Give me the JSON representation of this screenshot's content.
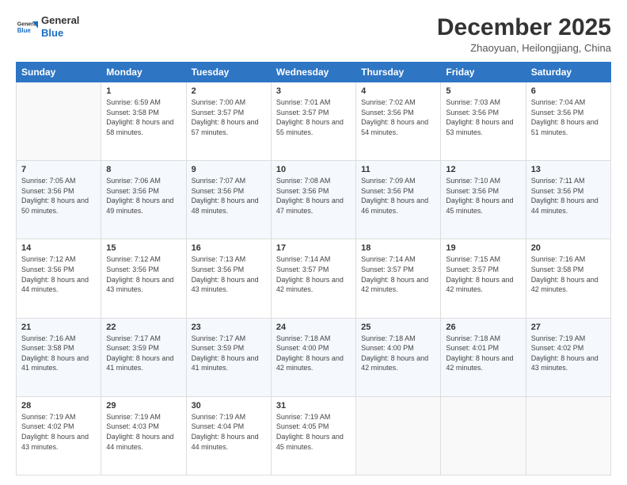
{
  "logo": {
    "line1": "General",
    "line2": "Blue"
  },
  "header": {
    "month": "December 2025",
    "location": "Zhaoyuan, Heilongjiang, China"
  },
  "weekdays": [
    "Sunday",
    "Monday",
    "Tuesday",
    "Wednesday",
    "Thursday",
    "Friday",
    "Saturday"
  ],
  "weeks": [
    [
      {
        "day": "",
        "sunrise": "",
        "sunset": "",
        "daylight": ""
      },
      {
        "day": "1",
        "sunrise": "Sunrise: 6:59 AM",
        "sunset": "Sunset: 3:58 PM",
        "daylight": "Daylight: 8 hours and 58 minutes."
      },
      {
        "day": "2",
        "sunrise": "Sunrise: 7:00 AM",
        "sunset": "Sunset: 3:57 PM",
        "daylight": "Daylight: 8 hours and 57 minutes."
      },
      {
        "day": "3",
        "sunrise": "Sunrise: 7:01 AM",
        "sunset": "Sunset: 3:57 PM",
        "daylight": "Daylight: 8 hours and 55 minutes."
      },
      {
        "day": "4",
        "sunrise": "Sunrise: 7:02 AM",
        "sunset": "Sunset: 3:56 PM",
        "daylight": "Daylight: 8 hours and 54 minutes."
      },
      {
        "day": "5",
        "sunrise": "Sunrise: 7:03 AM",
        "sunset": "Sunset: 3:56 PM",
        "daylight": "Daylight: 8 hours and 53 minutes."
      },
      {
        "day": "6",
        "sunrise": "Sunrise: 7:04 AM",
        "sunset": "Sunset: 3:56 PM",
        "daylight": "Daylight: 8 hours and 51 minutes."
      }
    ],
    [
      {
        "day": "7",
        "sunrise": "Sunrise: 7:05 AM",
        "sunset": "Sunset: 3:56 PM",
        "daylight": "Daylight: 8 hours and 50 minutes."
      },
      {
        "day": "8",
        "sunrise": "Sunrise: 7:06 AM",
        "sunset": "Sunset: 3:56 PM",
        "daylight": "Daylight: 8 hours and 49 minutes."
      },
      {
        "day": "9",
        "sunrise": "Sunrise: 7:07 AM",
        "sunset": "Sunset: 3:56 PM",
        "daylight": "Daylight: 8 hours and 48 minutes."
      },
      {
        "day": "10",
        "sunrise": "Sunrise: 7:08 AM",
        "sunset": "Sunset: 3:56 PM",
        "daylight": "Daylight: 8 hours and 47 minutes."
      },
      {
        "day": "11",
        "sunrise": "Sunrise: 7:09 AM",
        "sunset": "Sunset: 3:56 PM",
        "daylight": "Daylight: 8 hours and 46 minutes."
      },
      {
        "day": "12",
        "sunrise": "Sunrise: 7:10 AM",
        "sunset": "Sunset: 3:56 PM",
        "daylight": "Daylight: 8 hours and 45 minutes."
      },
      {
        "day": "13",
        "sunrise": "Sunrise: 7:11 AM",
        "sunset": "Sunset: 3:56 PM",
        "daylight": "Daylight: 8 hours and 44 minutes."
      }
    ],
    [
      {
        "day": "14",
        "sunrise": "Sunrise: 7:12 AM",
        "sunset": "Sunset: 3:56 PM",
        "daylight": "Daylight: 8 hours and 44 minutes."
      },
      {
        "day": "15",
        "sunrise": "Sunrise: 7:12 AM",
        "sunset": "Sunset: 3:56 PM",
        "daylight": "Daylight: 8 hours and 43 minutes."
      },
      {
        "day": "16",
        "sunrise": "Sunrise: 7:13 AM",
        "sunset": "Sunset: 3:56 PM",
        "daylight": "Daylight: 8 hours and 43 minutes."
      },
      {
        "day": "17",
        "sunrise": "Sunrise: 7:14 AM",
        "sunset": "Sunset: 3:57 PM",
        "daylight": "Daylight: 8 hours and 42 minutes."
      },
      {
        "day": "18",
        "sunrise": "Sunrise: 7:14 AM",
        "sunset": "Sunset: 3:57 PM",
        "daylight": "Daylight: 8 hours and 42 minutes."
      },
      {
        "day": "19",
        "sunrise": "Sunrise: 7:15 AM",
        "sunset": "Sunset: 3:57 PM",
        "daylight": "Daylight: 8 hours and 42 minutes."
      },
      {
        "day": "20",
        "sunrise": "Sunrise: 7:16 AM",
        "sunset": "Sunset: 3:58 PM",
        "daylight": "Daylight: 8 hours and 42 minutes."
      }
    ],
    [
      {
        "day": "21",
        "sunrise": "Sunrise: 7:16 AM",
        "sunset": "Sunset: 3:58 PM",
        "daylight": "Daylight: 8 hours and 41 minutes."
      },
      {
        "day": "22",
        "sunrise": "Sunrise: 7:17 AM",
        "sunset": "Sunset: 3:59 PM",
        "daylight": "Daylight: 8 hours and 41 minutes."
      },
      {
        "day": "23",
        "sunrise": "Sunrise: 7:17 AM",
        "sunset": "Sunset: 3:59 PM",
        "daylight": "Daylight: 8 hours and 41 minutes."
      },
      {
        "day": "24",
        "sunrise": "Sunrise: 7:18 AM",
        "sunset": "Sunset: 4:00 PM",
        "daylight": "Daylight: 8 hours and 42 minutes."
      },
      {
        "day": "25",
        "sunrise": "Sunrise: 7:18 AM",
        "sunset": "Sunset: 4:00 PM",
        "daylight": "Daylight: 8 hours and 42 minutes."
      },
      {
        "day": "26",
        "sunrise": "Sunrise: 7:18 AM",
        "sunset": "Sunset: 4:01 PM",
        "daylight": "Daylight: 8 hours and 42 minutes."
      },
      {
        "day": "27",
        "sunrise": "Sunrise: 7:19 AM",
        "sunset": "Sunset: 4:02 PM",
        "daylight": "Daylight: 8 hours and 43 minutes."
      }
    ],
    [
      {
        "day": "28",
        "sunrise": "Sunrise: 7:19 AM",
        "sunset": "Sunset: 4:02 PM",
        "daylight": "Daylight: 8 hours and 43 minutes."
      },
      {
        "day": "29",
        "sunrise": "Sunrise: 7:19 AM",
        "sunset": "Sunset: 4:03 PM",
        "daylight": "Daylight: 8 hours and 44 minutes."
      },
      {
        "day": "30",
        "sunrise": "Sunrise: 7:19 AM",
        "sunset": "Sunset: 4:04 PM",
        "daylight": "Daylight: 8 hours and 44 minutes."
      },
      {
        "day": "31",
        "sunrise": "Sunrise: 7:19 AM",
        "sunset": "Sunset: 4:05 PM",
        "daylight": "Daylight: 8 hours and 45 minutes."
      },
      {
        "day": "",
        "sunrise": "",
        "sunset": "",
        "daylight": ""
      },
      {
        "day": "",
        "sunrise": "",
        "sunset": "",
        "daylight": ""
      },
      {
        "day": "",
        "sunrise": "",
        "sunset": "",
        "daylight": ""
      }
    ]
  ]
}
